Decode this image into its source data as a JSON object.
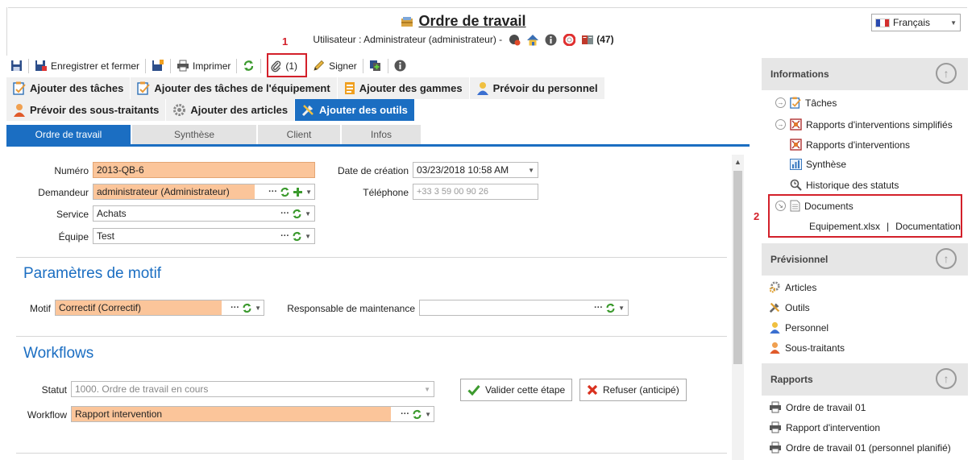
{
  "header": {
    "title": "Ordre de travail",
    "user_line": "Utilisateur : Administrateur (administrateur)  -",
    "badge_count": "(47)",
    "language": "Français"
  },
  "toolbar": {
    "save_close": "Enregistrer et fermer",
    "print": "Imprimer",
    "attachments": "(1)",
    "sign": "Signer"
  },
  "annotations": {
    "marker_1": "1",
    "marker_2": "2"
  },
  "actions": {
    "add_tasks": "Ajouter des tâches",
    "add_equipment_tasks": "Ajouter des tâches de l'équipement",
    "add_ranges": "Ajouter des gammes",
    "plan_staff": "Prévoir du personnel",
    "plan_subcontractors": "Prévoir des sous-traitants",
    "add_articles": "Ajouter des articles",
    "add_tools": "Ajouter des outils"
  },
  "tabs": [
    "Ordre de travail",
    "Synthèse",
    "Client",
    "Infos"
  ],
  "form": {
    "numero_label": "Numéro",
    "numero_value": "2013-QB-6",
    "demandeur_label": "Demandeur",
    "demandeur_value": "administrateur (Administrateur)",
    "service_label": "Service",
    "service_value": "Achats",
    "equipe_label": "Équipe",
    "equipe_value": "Test",
    "date_label": "Date de création",
    "date_value": "03/23/2018 10:58 AM",
    "phone_label": "Téléphone",
    "phone_placeholder": "+33 3 59 00 90 26"
  },
  "motif_section": {
    "title": "Paramètres de motif",
    "motif_label": "Motif",
    "motif_value": "Correctif (Correctif)",
    "resp_label": "Responsable de maintenance",
    "resp_value": ""
  },
  "workflow_section": {
    "title": "Workflows",
    "statut_label": "Statut",
    "statut_value": "1000. Ordre de travail en cours",
    "validate_label": "Valider cette étape",
    "refuse_label": "Refuser (anticipé)",
    "workflow_label": "Workflow",
    "workflow_value": "Rapport intervention"
  },
  "right_panel": {
    "informations": {
      "title": "Informations",
      "items": [
        "Tâches",
        "Rapports d'interventions simplifiés",
        "Rapports d'interventions",
        "Synthèse",
        "Historique des statuts"
      ],
      "documents_label": "Documents",
      "doc_file": "Equipement.xlsx",
      "doc_sep": "|",
      "doc_link": "Documentation"
    },
    "previsionnel": {
      "title": "Prévisionnel",
      "items": [
        "Articles",
        "Outils",
        "Personnel",
        "Sous-traitants"
      ]
    },
    "rapports": {
      "title": "Rapports",
      "items": [
        "Ordre de travail 01",
        "Rapport d'intervention",
        "Ordre de travail 01 (personnel planifié)"
      ]
    }
  },
  "colors": {
    "accent": "#1b6ec2",
    "required_field": "#fbc59a",
    "annotation_red": "#d3202a"
  }
}
